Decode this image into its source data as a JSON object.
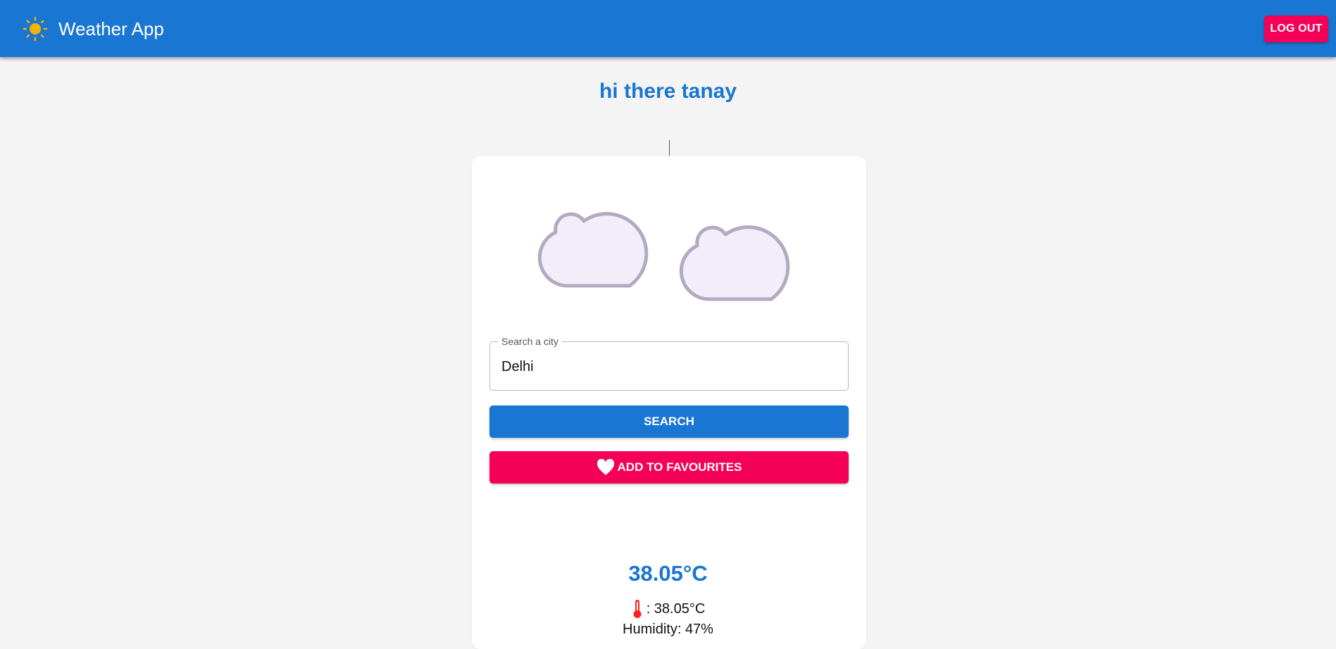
{
  "header": {
    "logo_icon": "sun-icon",
    "title": "Weather App",
    "logout_label": "LOG OUT"
  },
  "greeting": "hi there tanay",
  "weather_icon": "clouds-icon",
  "search": {
    "label": "Search a city",
    "value": "Delhi",
    "button_label": "SEARCH"
  },
  "favourites": {
    "icon": "heart-icon",
    "button_label": "ADD TO FAVOURITES"
  },
  "weather": {
    "temperature": "38.05°C",
    "feels_icon": "thermometer-icon",
    "feels_like": ": 38.05°C",
    "humidity": "Humidity: 47%"
  },
  "colors": {
    "primary": "#1976d2",
    "secondary": "#f50057",
    "background": "#f4f4f4",
    "sun": "#f5b400"
  }
}
